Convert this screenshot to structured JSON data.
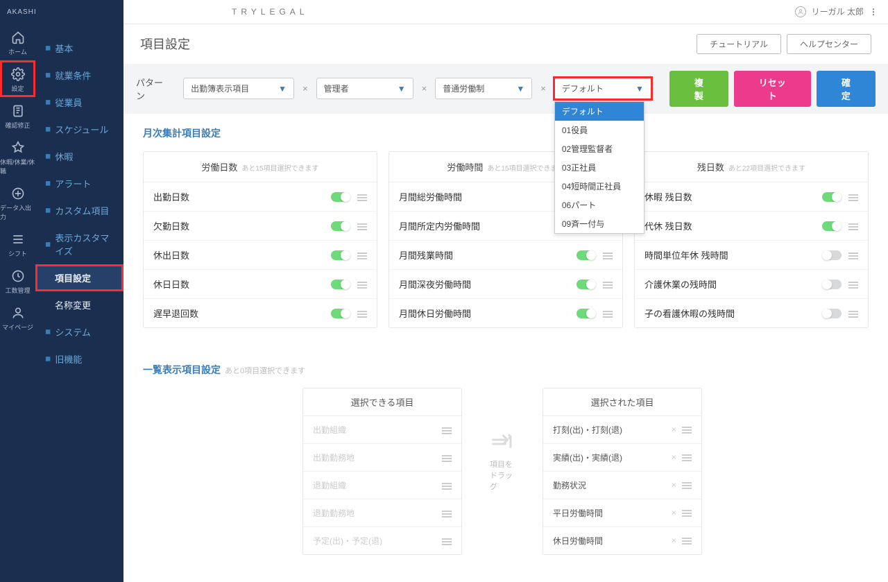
{
  "brand": "AKASHI",
  "tenant": "TRYLEGAL",
  "user_name": "リーガル 太郎",
  "rail": [
    {
      "key": "home",
      "label": "ホーム"
    },
    {
      "key": "settings",
      "label": "設定"
    },
    {
      "key": "approve",
      "label": "確認修正"
    },
    {
      "key": "leave",
      "label": "休暇/休業/休職"
    },
    {
      "key": "io",
      "label": "データ入出力"
    },
    {
      "key": "shift",
      "label": "シフト"
    },
    {
      "key": "work",
      "label": "工数管理"
    },
    {
      "key": "mypage",
      "label": "マイページ"
    }
  ],
  "sidebar": {
    "items": [
      {
        "label": "基本"
      },
      {
        "label": "就業条件"
      },
      {
        "label": "従業員"
      },
      {
        "label": "スケジュール"
      },
      {
        "label": "休暇"
      },
      {
        "label": "アラート"
      },
      {
        "label": "カスタム項目"
      },
      {
        "label": "表示カスタマイズ"
      }
    ],
    "subitems": [
      {
        "label": "項目設定",
        "active": true
      },
      {
        "label": "名称変更"
      }
    ],
    "items2": [
      {
        "label": "システム"
      },
      {
        "label": "旧機能"
      }
    ]
  },
  "page_title": "項目設定",
  "buttons": {
    "tutorial": "チュートリアル",
    "help": "ヘルプセンター",
    "copy": "複製",
    "reset": "リセット",
    "confirm": "確定"
  },
  "filters": {
    "label": "パターン",
    "select1": "出勤簿表示項目",
    "select2": "管理者",
    "select3": "普通労働制",
    "select4": "デフォルト"
  },
  "dropdown_options": [
    "デフォルト",
    "01役員",
    "02管理監督者",
    "03正社員",
    "04短時間正社員",
    "06パート",
    "09斉一付与"
  ],
  "section1_title": "月次集計項目設定",
  "cards": [
    {
      "title": "労働日数",
      "sub": "あと15項目選択できます",
      "rows": [
        {
          "label": "出勤日数",
          "on": true
        },
        {
          "label": "欠勤日数",
          "on": true
        },
        {
          "label": "休出日数",
          "on": true
        },
        {
          "label": "休日日数",
          "on": true
        },
        {
          "label": "遅早退回数",
          "on": true
        }
      ]
    },
    {
      "title": "労働時間",
      "sub": "あと15項目選択できます",
      "rows": [
        {
          "label": "月間総労働時間",
          "on": true
        },
        {
          "label": "月間所定内労働時間",
          "on": true
        },
        {
          "label": "月間残業時間",
          "on": true
        },
        {
          "label": "月間深夜労働時間",
          "on": true
        },
        {
          "label": "月間休日労働時間",
          "on": true
        }
      ]
    },
    {
      "title": "残日数",
      "sub": "あと22項目選択できます",
      "rows": [
        {
          "label": "休暇 残日数",
          "on": true
        },
        {
          "label": "代休 残日数",
          "on": true
        },
        {
          "label": "時間単位年休 残時間",
          "on": false
        },
        {
          "label": "介護休業の残時間",
          "on": false
        },
        {
          "label": "子の看護休暇の残時間",
          "on": false
        }
      ]
    }
  ],
  "section2_title": "一覧表示項目設定",
  "section2_sub": "あと0項目選択できます",
  "available": {
    "title": "選択できる項目",
    "rows": [
      "出勤組織",
      "出勤勤務地",
      "退勤組織",
      "退勤勤務地",
      "予定(出)・予定(退)"
    ]
  },
  "drag_label": "項目をドラッグ",
  "selected": {
    "title": "選択された項目",
    "rows": [
      "打刻(出)・打刻(退)",
      "実績(出)・実績(退)",
      "勤務状況",
      "平日労働時間",
      "休日労働時間"
    ]
  }
}
